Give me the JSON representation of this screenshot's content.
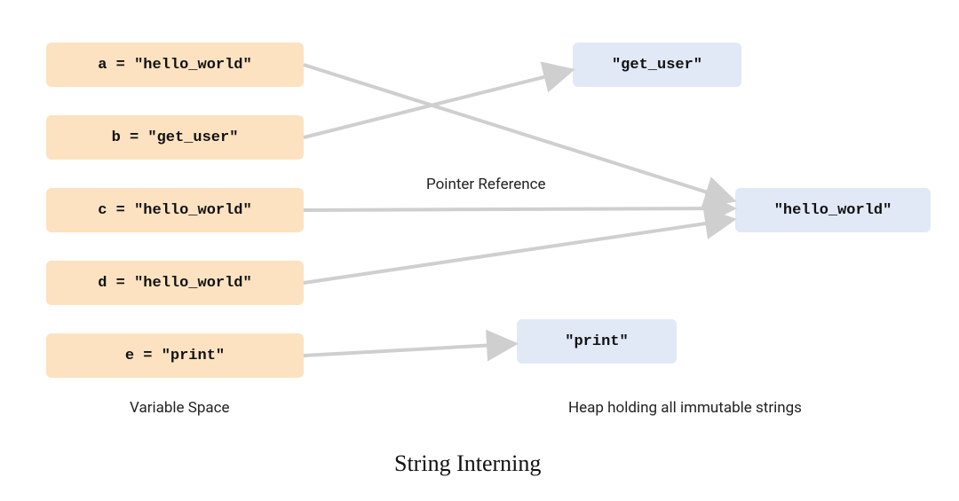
{
  "title": "String Interning",
  "left_label": "Variable Space",
  "right_label": "Heap holding all immutable strings",
  "pointer_label": "Pointer Reference",
  "variables": [
    {
      "code": "a = \"hello_world\""
    },
    {
      "code": "b = \"get_user\""
    },
    {
      "code": "c = \"hello_world\""
    },
    {
      "code": "d = \"hello_world\""
    },
    {
      "code": "e = \"print\""
    }
  ],
  "heap": [
    {
      "value": "\"get_user\""
    },
    {
      "value": "\"hello_world\""
    },
    {
      "value": "\"print\""
    }
  ],
  "arrows": [
    {
      "from": "a",
      "to": "hello_world"
    },
    {
      "from": "b",
      "to": "get_user"
    },
    {
      "from": "c",
      "to": "hello_world"
    },
    {
      "from": "d",
      "to": "hello_world"
    },
    {
      "from": "e",
      "to": "print"
    }
  ]
}
